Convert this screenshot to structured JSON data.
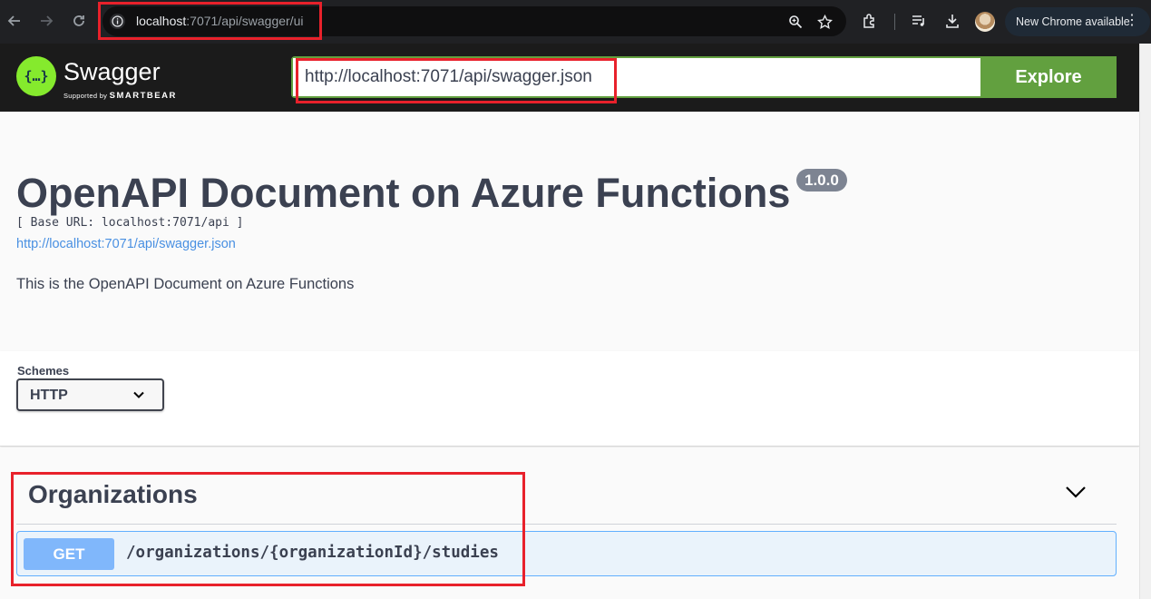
{
  "browser": {
    "url_host": "localhost",
    "url_rest": ":7071/api/swagger/ui",
    "new_chrome_label": "New Chrome available"
  },
  "topbar": {
    "brand": "Swagger",
    "brand_sub_prefix": "Supported by",
    "brand_sub_company": "SMARTBEAR",
    "spec_url_value": "http://localhost:7071/api/swagger.json",
    "explore_label": "Explore"
  },
  "info": {
    "title": "OpenAPI Document on Azure Functions",
    "version": "1.0.0",
    "base_url": "[ Base URL: localhost:7071/api ]",
    "spec_link": "http://localhost:7071/api/swagger.json",
    "description": "This is the OpenAPI Document on Azure Functions"
  },
  "schemes": {
    "label": "Schemes",
    "selected": "HTTP"
  },
  "operations": {
    "tag": "Organizations",
    "items": [
      {
        "method": "GET",
        "path": "/organizations/{organizationId}/studies"
      }
    ]
  },
  "colors": {
    "swagger_green": "#85ea2d",
    "explore_green": "#62a03f",
    "get_blue": "#61affe",
    "highlight_red": "#e8212b"
  }
}
